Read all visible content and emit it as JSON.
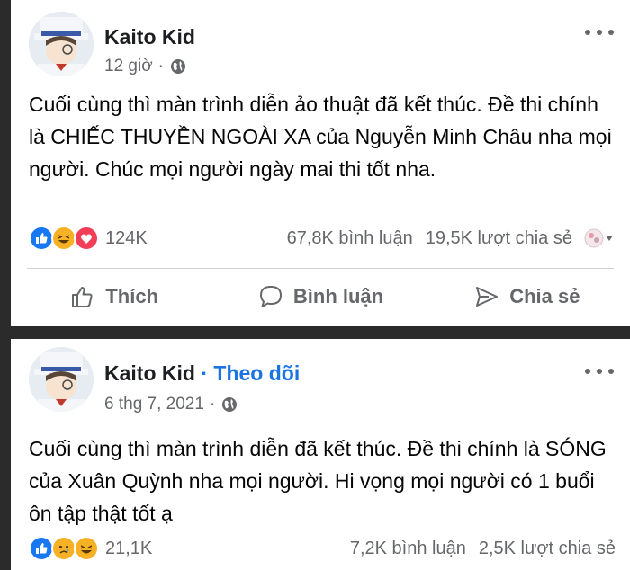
{
  "posts": [
    {
      "author": "Kaito Kid",
      "follow_label": "",
      "time": "12 giờ",
      "separator": "·",
      "text": "Cuối cùng thì màn trình diễn ảo thuật đã kết thúc. Đề thi chính là CHIẾC THUYỀN NGOÀI XA của Nguyễn Minh Châu nha mọi người. Chúc mọi người ngày mai thi tốt nha.",
      "reaction_count": "124K",
      "comments": "67,8K bình luận",
      "shares": "19,5K lượt chia sẻ",
      "reaction_icons": [
        "like-icon",
        "haha-icon",
        "love-icon"
      ]
    },
    {
      "author": "Kaito Kid",
      "follow_label": "· Theo dõi",
      "time": "6 thg 7, 2021",
      "separator": "·",
      "text": "Cuối cùng thì màn trình diễn đã kết thúc. Đề thi chính là SÓNG của Xuân Quỳnh nha mọi người. Hi vọng mọi người có 1 buổi ôn tập thật tốt ạ",
      "reaction_count": "21,1K",
      "comments": "7,2K bình luận",
      "shares": "2,5K lượt chia sẻ",
      "reaction_icons": [
        "like-icon",
        "sad-icon",
        "haha-icon"
      ]
    }
  ],
  "actions": {
    "like": "Thích",
    "comment": "Bình luận",
    "share": "Chia sẻ"
  },
  "colors": {
    "like": "#1877f2",
    "love": "#f33e58",
    "haha": "#f7b125",
    "follow": "#1b74e4",
    "muted": "#65676b"
  }
}
